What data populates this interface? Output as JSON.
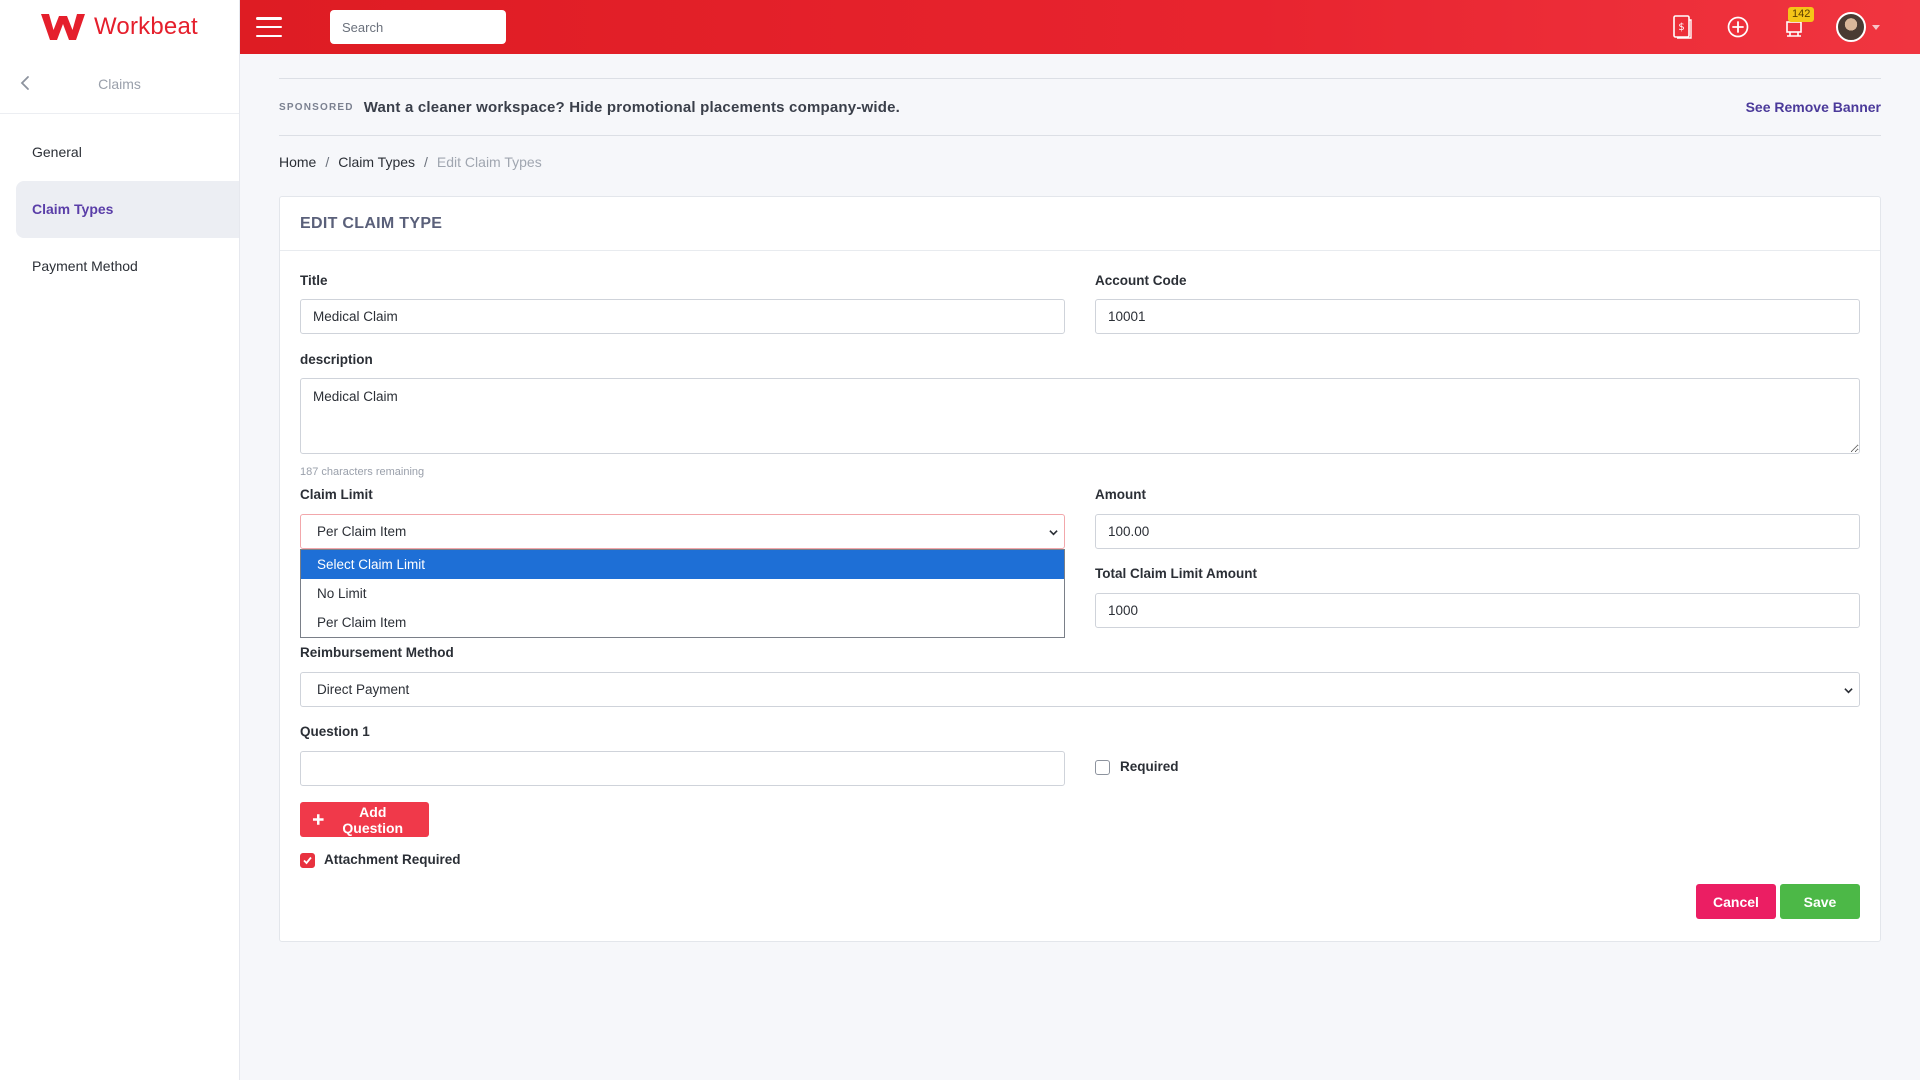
{
  "brand": {
    "name": "Workbeat",
    "color": "#e51f2c"
  },
  "sidebar": {
    "title": "Claims",
    "items": [
      {
        "label": "General",
        "active": false
      },
      {
        "label": "Claim Types",
        "active": true
      },
      {
        "label": "Payment Method",
        "active": false
      }
    ]
  },
  "topbar": {
    "search_placeholder": "Search",
    "icons": [
      "invoice-icon",
      "add-circle-icon",
      "trophy-icon",
      "avatar"
    ],
    "notification_count": "142"
  },
  "sponsor": {
    "tag": "SPONSORED",
    "message": "Want a cleaner workspace? Hide promotional placements company-wide.",
    "link": "See Remove Banner"
  },
  "breadcrumb": {
    "home": "Home",
    "list": "Claim Types",
    "current": "Edit Claim Types",
    "separator": "/"
  },
  "form": {
    "heading": "EDIT CLAIM TYPE",
    "title_label": "Title",
    "title_value": "Medical Claim",
    "account_code_label": "Account Code",
    "account_code_value": "10001",
    "description_label": "description",
    "description_value": "Medical Claim",
    "chars_remaining": "187 characters remaining",
    "claim_limit_label": "Claim Limit",
    "claim_limit_value": "Per Claim Item",
    "claim_limit_options": [
      "Select Claim Limit",
      "No Limit",
      "Per Claim Item"
    ],
    "amount_label": "Amount",
    "amount_value": "100.00",
    "total_limit_label": "Total Claim Limit Amount",
    "total_limit_value": "1000",
    "reimbursement_label": "Reimbursement Method",
    "reimbursement_value": "Direct Payment",
    "question_label": "Question 1",
    "question_value": "",
    "required_label": "Required",
    "required_checked": false,
    "add_question_label": "Add Question",
    "attachment_label": "Attachment Required",
    "attachment_checked": true,
    "cancel_label": "Cancel",
    "save_label": "Save"
  },
  "colors": {
    "topbar": "#e51f2c",
    "accent_purple": "#5a3ea8",
    "add_button": "#f0394a",
    "cancel_button": "#eb1e63",
    "save_button": "#4cb847",
    "dropdown_highlight": "#1e6fd6"
  }
}
